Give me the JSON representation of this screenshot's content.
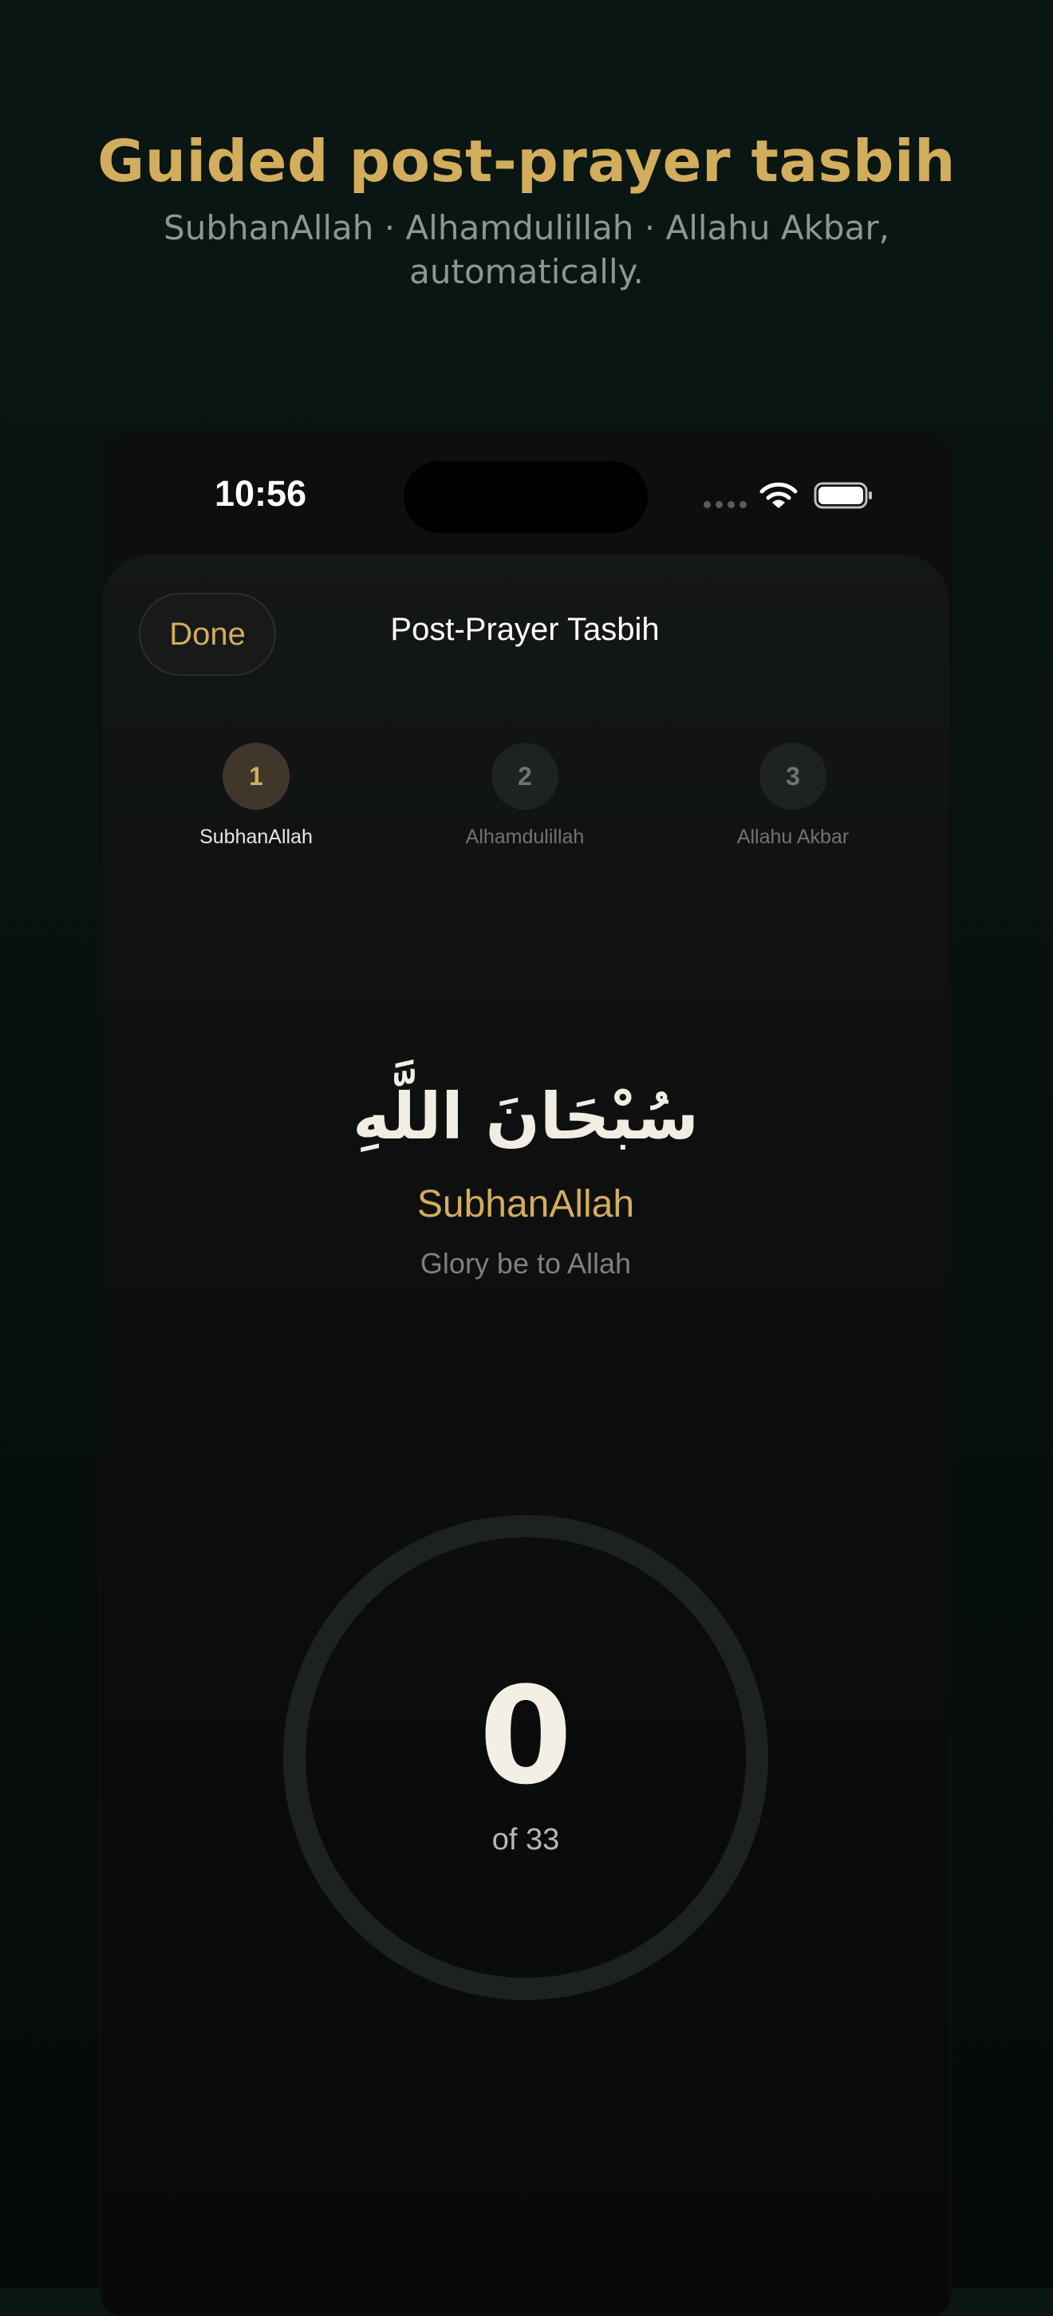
{
  "hero": {
    "title": "Guided post-prayer tasbih",
    "subtitle": "SubhanAllah · Alhamdulillah · Allahu Akbar, automatically."
  },
  "status_bar": {
    "time": "10:56",
    "icons": [
      "signal-dots-icon",
      "wifi-icon",
      "battery-icon"
    ]
  },
  "nav": {
    "done_label": "Done",
    "title": "Post-Prayer Tasbih"
  },
  "steps": [
    {
      "number": "1",
      "label": "SubhanAllah",
      "active": true
    },
    {
      "number": "2",
      "label": "Alhamdulillah",
      "active": false
    },
    {
      "number": "3",
      "label": "Allahu Akbar",
      "active": false
    }
  ],
  "dhikr": {
    "arabic": "سُبْحَانَ اللَّهِ",
    "transliteration": "SubhanAllah",
    "translation": "Glory be to Allah"
  },
  "counter": {
    "count": "0",
    "target_text": "of 33",
    "progress": 0
  },
  "colors": {
    "accent": "#d2ad5c",
    "ring": "#1e2121",
    "background": "#0b1714"
  }
}
